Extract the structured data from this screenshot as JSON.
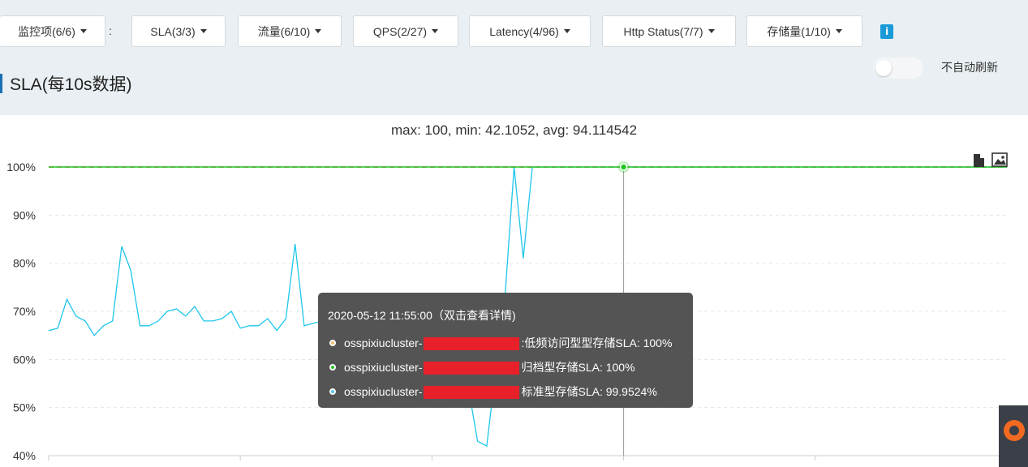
{
  "filters": [
    {
      "label": "监控项(6/6)"
    },
    {
      "label": "SLA(3/3)"
    },
    {
      "label": "流量(6/10)"
    },
    {
      "label": "QPS(2/27)"
    },
    {
      "label": "Latency(4/96)"
    },
    {
      "label": "Http Status(7/7)"
    },
    {
      "label": "存储量(1/10)"
    }
  ],
  "separator": ":",
  "info_icon_text": "i",
  "toggle_label": "不自动刷新",
  "section_title": "SLA(每10s数据)",
  "stats_line": "max: 100, min: 42.1052, avg: 94.114542",
  "tooltip": {
    "time": "2020-05-12 11:55:00（双击查看详情)",
    "rows": [
      {
        "prefix": "osspixiucluster-",
        "suffix": ":低频访问型型存储SLA: 100%",
        "color": "#f0c070"
      },
      {
        "prefix": "osspixiucluster-",
        "suffix": "归档型存储SLA: 100%",
        "color": "#22c722"
      },
      {
        "prefix": "osspixiucluster-",
        "suffix": "标准型存储SLA: 99.9524%",
        "color": "#5bc8f0"
      }
    ]
  },
  "chart_data": {
    "type": "line",
    "title": "max: 100, min: 42.1052, avg: 94.114542",
    "ylim": [
      40,
      100
    ],
    "ytick_labels": [
      "100%",
      "90%",
      "80%",
      "70%",
      "60%",
      "50%",
      "40%"
    ],
    "yticks": [
      100,
      90,
      80,
      70,
      60,
      50,
      40
    ],
    "grid": true,
    "series": [
      {
        "color": "#e8202a",
        "dashed": true,
        "values": [
          100,
          100,
          100,
          100,
          100,
          100,
          100,
          100,
          100,
          100,
          100,
          100,
          100,
          100,
          100,
          100,
          100,
          100,
          100,
          100,
          100,
          100,
          100,
          100,
          100,
          100,
          100,
          100,
          100,
          100,
          100,
          100,
          100,
          100,
          100,
          100,
          100,
          100,
          100,
          100,
          100,
          100,
          100,
          100,
          100,
          100,
          100,
          100,
          100,
          100,
          100,
          100,
          100,
          100,
          100,
          100,
          100,
          100,
          100,
          100,
          100,
          100,
          100,
          100,
          100,
          100,
          100,
          100,
          100,
          100,
          100,
          100,
          100,
          100,
          100,
          100,
          100,
          100,
          100,
          100,
          100,
          100,
          100,
          100,
          100,
          100,
          100,
          100,
          100,
          100,
          100,
          100,
          100,
          100,
          100,
          100,
          100,
          100,
          100,
          100,
          100,
          100,
          100,
          100,
          100,
          100
        ]
      },
      {
        "color": "#22c722",
        "dashed": false,
        "values": [
          100,
          100,
          100,
          100,
          100,
          100,
          100,
          100,
          100,
          100,
          100,
          100,
          100,
          100,
          100,
          100,
          100,
          100,
          100,
          100,
          100,
          100,
          100,
          100,
          100,
          100,
          100,
          100,
          100,
          100,
          100,
          100,
          100,
          100,
          100,
          100,
          100,
          100,
          100,
          100,
          100,
          100,
          100,
          100,
          100,
          100,
          100,
          100,
          100,
          100,
          100,
          100,
          100,
          100,
          100,
          100,
          100,
          100,
          100,
          100,
          100,
          100,
          100,
          100,
          100,
          100,
          100,
          100,
          100,
          100,
          100,
          100,
          100,
          100,
          100,
          100,
          100,
          100,
          100,
          100,
          100,
          100,
          100,
          100,
          100,
          100,
          100,
          100,
          100,
          100,
          100,
          100,
          100,
          100,
          100,
          100,
          100,
          100,
          100,
          100,
          100,
          100,
          100,
          100,
          100,
          100
        ]
      },
      {
        "color": "#1ec6ec",
        "dashed": false,
        "values": [
          66,
          66.5,
          72.5,
          69,
          68,
          65,
          67,
          68,
          83.5,
          78.5,
          67,
          67,
          68,
          70,
          70.5,
          69,
          71,
          68,
          68,
          68.5,
          70,
          66.5,
          67,
          67,
          68.5,
          66,
          68.5,
          84,
          67,
          67.5,
          68,
          68,
          69,
          68,
          66.5,
          66,
          67.5,
          67,
          68,
          68,
          69,
          67,
          66,
          65,
          60,
          61,
          54,
          43,
          42,
          58,
          73,
          100,
          81,
          100,
          100,
          100,
          100,
          100,
          100,
          100,
          100,
          100,
          100,
          100,
          100,
          100,
          100,
          100,
          100,
          100,
          100,
          100,
          100,
          100,
          100,
          100,
          100,
          100,
          100,
          100,
          100,
          100,
          100,
          100,
          100,
          100,
          100,
          100,
          100,
          100,
          100,
          100,
          100,
          100,
          100,
          100,
          100,
          100,
          100,
          100,
          100,
          100,
          100,
          100,
          100,
          100
        ]
      }
    ],
    "hover_index": 63
  }
}
